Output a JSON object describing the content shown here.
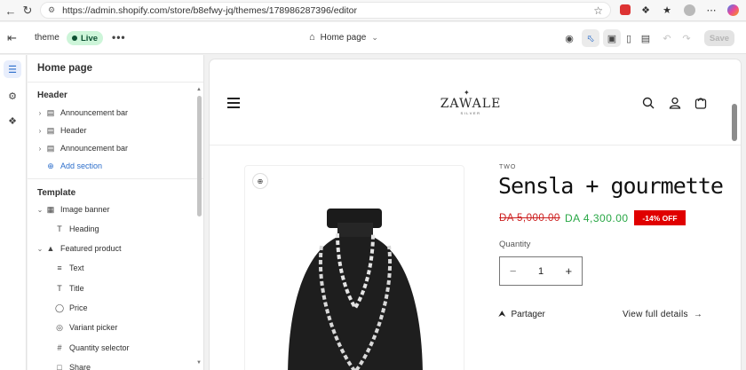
{
  "browser": {
    "url": "https://admin.shopify.com/store/b8efwy-jq/themes/178986287396/editor",
    "back_icon": "arrow-left",
    "reload_icon": "reload",
    "lock_icon": "site-info",
    "star_icon": "star"
  },
  "topbar": {
    "theme_name": "theme",
    "status": "Live",
    "page_selector": "Home page",
    "save_label": "Save"
  },
  "sidebar": {
    "title": "Home page",
    "header_group": {
      "title": "Header",
      "items": [
        {
          "label": "Announcement bar",
          "icon": "section-icon"
        },
        {
          "label": "Header",
          "icon": "section-icon"
        },
        {
          "label": "Announcement bar",
          "icon": "section-icon"
        }
      ],
      "add_label": "Add section"
    },
    "template_group": {
      "title": "Template",
      "items": [
        {
          "label": "Image banner",
          "icon": "image-icon",
          "level": 1
        },
        {
          "label": "Heading",
          "icon": "text-T-icon",
          "level": 2
        },
        {
          "label": "Featured product",
          "icon": "product-icon",
          "level": 1
        },
        {
          "label": "Text",
          "icon": "lines-icon",
          "level": 2
        },
        {
          "label": "Title",
          "icon": "text-T-icon",
          "level": 2
        },
        {
          "label": "Price",
          "icon": "price-tag-icon",
          "level": 2
        },
        {
          "label": "Variant picker",
          "icon": "variant-icon",
          "level": 2
        },
        {
          "label": "Quantity selector",
          "icon": "hash-icon",
          "level": 2
        },
        {
          "label": "Share",
          "icon": "share-icon",
          "level": 2
        }
      ]
    }
  },
  "preview": {
    "logo_text": "ZAWALE",
    "logo_subtext": "SILVER",
    "vendor": "TWO",
    "product_title": "Sensla + gourmette",
    "old_price": "DA 5,000.00",
    "new_price": "DA 4,300.00",
    "discount_badge": "-14% OFF",
    "quantity_label": "Quantity",
    "quantity_value": "1",
    "share_label": "Partager",
    "view_details_label": "View full details",
    "colors": {
      "sale_price": "#28a745",
      "old_price": "#cc1f1f",
      "badge": "#e00000"
    }
  }
}
